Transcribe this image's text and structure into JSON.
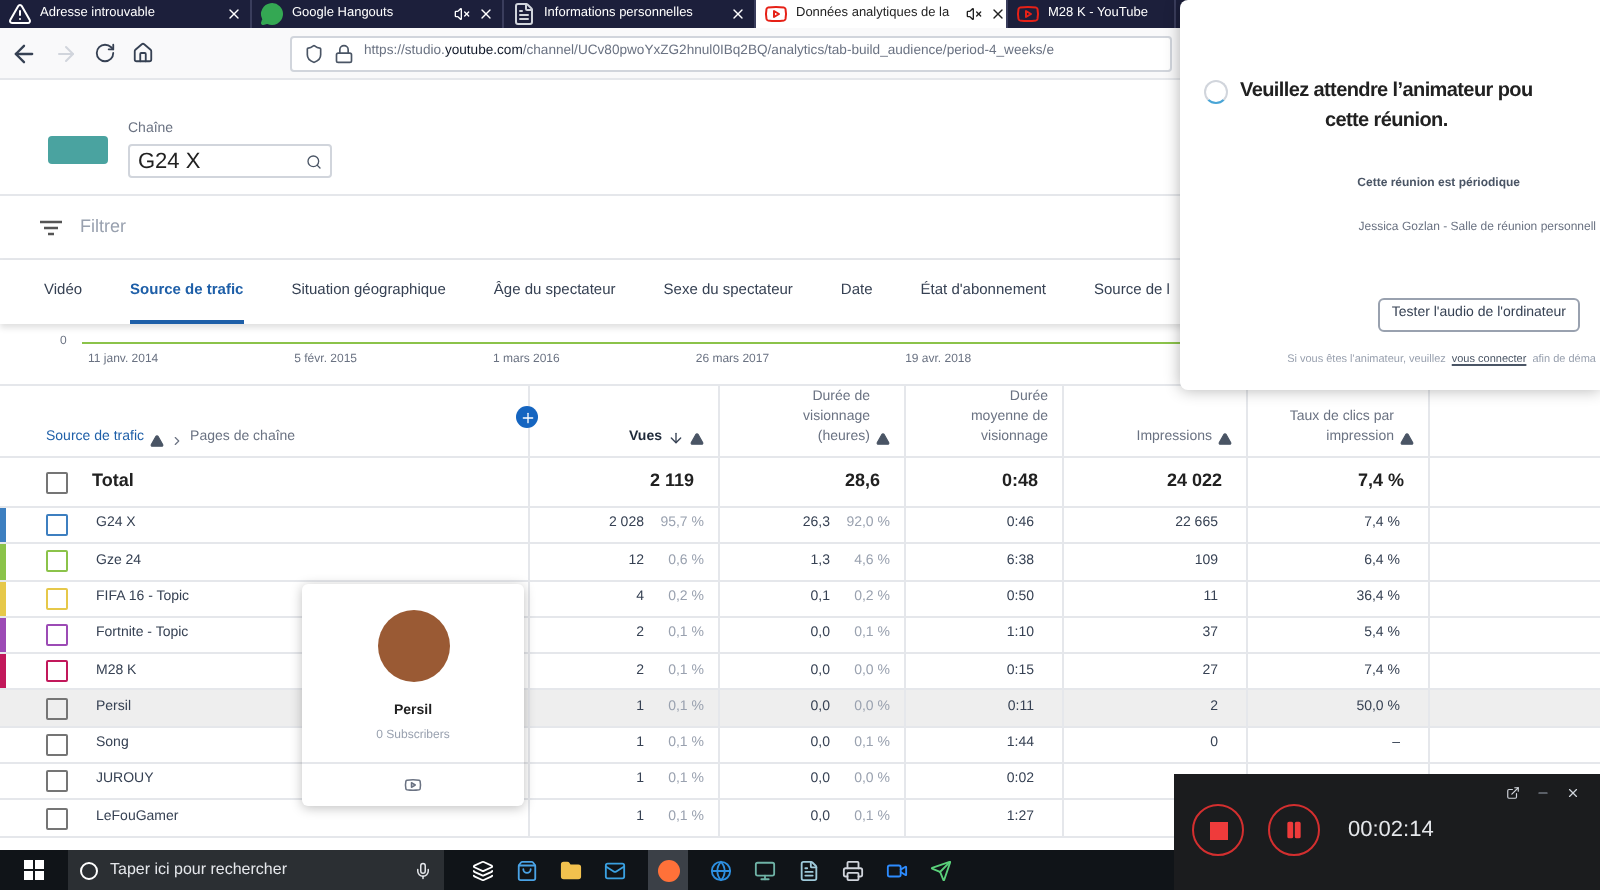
{
  "browser_tabs": [
    {
      "title": "Adresse introuvable",
      "kind": "warning",
      "muted": false,
      "selected": false
    },
    {
      "title": "Google Hangouts",
      "kind": "chat",
      "muted": true,
      "selected": false
    },
    {
      "title": "Informations personnelles",
      "kind": "document",
      "muted": false,
      "selected": false
    },
    {
      "title": "Données analytiques de la",
      "kind": "play",
      "muted": true,
      "selected": true
    },
    {
      "title": "M28 K - YouTube",
      "kind": "play",
      "muted": false,
      "selected": false
    }
  ],
  "address_bar": {
    "url": "https://studio.**youtube.com**/channel/UCv80pwoYxZG2hnul0IBq2BQ/analytics/tab-build_audience/period-4_weeks/e"
  },
  "channel": {
    "label": "Chaîne",
    "value": "G24 X"
  },
  "filter": {
    "placeholder": "Filtrer"
  },
  "report_tabs": [
    {
      "label": "Vidéo",
      "selected": false
    },
    {
      "label": "Source de trafic",
      "selected": true
    },
    {
      "label": "Situation géographique",
      "selected": false
    },
    {
      "label": "Âge du spectateur",
      "selected": false
    },
    {
      "label": "Sexe du spectateur",
      "selected": false
    },
    {
      "label": "Date",
      "selected": false
    },
    {
      "label": "État d'abonnement",
      "selected": false
    },
    {
      "label": "Source de l",
      "selected": false
    }
  ],
  "chart_axis": {
    "y_label": "0",
    "dates": [
      "11 janv. 2014",
      "5 févr. 2015",
      "1 mars 2016",
      "26 mars 2017",
      "19 avr. 2018"
    ]
  },
  "table": {
    "breadcrumb": {
      "link": "Source de trafic",
      "current": "Pages de chaîne"
    },
    "columns": [
      {
        "label": "Vues",
        "sorted": true,
        "warning": true
      },
      {
        "label": "Durée de visionnage (heures)",
        "sorted": false,
        "warning": true
      },
      {
        "label": "Durée moyenne de visionnage",
        "sorted": false,
        "warning": false
      },
      {
        "label": "Impressions",
        "sorted": false,
        "warning": true
      },
      {
        "label": "Taux de clics par impression",
        "sorted": false,
        "warning": true
      }
    ],
    "total": {
      "label": "Total",
      "checked": false,
      "views": "2 119",
      "hours": "28,6",
      "avg": "0:48",
      "impressions": "24 022",
      "ctr": "7,4 %"
    },
    "rows": [
      {
        "name": "G24 X",
        "color": "#3d7fc0",
        "checked": false,
        "highlighted": false,
        "views": "2 028",
        "views_pct": "95,7 %",
        "hours": "26,3",
        "hours_pct": "92,0 %",
        "avg": "0:46",
        "impressions": "22 665",
        "ctr": "7,4 %"
      },
      {
        "name": "Gze 24",
        "color": "#8bc34a",
        "checked": false,
        "highlighted": false,
        "views": "12",
        "views_pct": "0,6 %",
        "hours": "1,3",
        "hours_pct": "4,6 %",
        "avg": "6:38",
        "impressions": "109",
        "ctr": "6,4 %"
      },
      {
        "name": "FIFA 16 - Topic",
        "color": "#e6c84a",
        "checked": false,
        "highlighted": false,
        "views": "4",
        "views_pct": "0,2 %",
        "hours": "0,1",
        "hours_pct": "0,2 %",
        "avg": "0:50",
        "impressions": "11",
        "ctr": "36,4 %"
      },
      {
        "name": "Fortnite - Topic",
        "color": "#9c4bb5",
        "checked": false,
        "highlighted": false,
        "views": "2",
        "views_pct": "0,1 %",
        "hours": "0,0",
        "hours_pct": "0,1 %",
        "avg": "1:10",
        "impressions": "37",
        "ctr": "5,4 %"
      },
      {
        "name": "M28 K",
        "color": "#c2185b",
        "checked": false,
        "highlighted": false,
        "views": "2",
        "views_pct": "0,1 %",
        "hours": "0,0",
        "hours_pct": "0,0 %",
        "avg": "0:15",
        "impressions": "27",
        "ctr": "7,4 %"
      },
      {
        "name": "Persil",
        "checked": false,
        "highlighted": true,
        "views": "1",
        "views_pct": "0,1 %",
        "hours": "0,0",
        "hours_pct": "0,0 %",
        "avg": "0:11",
        "impressions": "2",
        "ctr": "50,0 %"
      },
      {
        "name": "Song",
        "checked": false,
        "highlighted": false,
        "views": "1",
        "views_pct": "0,1 %",
        "hours": "0,0",
        "hours_pct": "0,1 %",
        "avg": "1:44",
        "impressions": "0",
        "ctr": "–"
      },
      {
        "name": "JUROUY",
        "checked": false,
        "highlighted": false,
        "views": "1",
        "views_pct": "0,1 %",
        "hours": "0,0",
        "hours_pct": "0,0 %",
        "avg": "0:02"
      },
      {
        "name": "LeFouGamer",
        "checked": false,
        "highlighted": false,
        "views": "1",
        "views_pct": "0,1 %",
        "hours": "0,0",
        "hours_pct": "0,1 %",
        "avg": "1:27"
      }
    ]
  },
  "hover_card": {
    "name": "Persil",
    "subscribers": "0 Subscribers"
  },
  "meeting_panel": {
    "title_lines": [
      "Veuillez attendre l’animateur pou",
      "cette réunion."
    ],
    "recurring": "Cette réunion est périodique",
    "host": "Jessica Gozlan - Salle de réunion personnell",
    "test_button": "Tester l'audio de l'ordinateur",
    "footer": {
      "before": "Si vous êtes l'animateur, veuillez",
      "link": "vous connecter",
      "after": "afin de déma"
    }
  },
  "recorder": {
    "time": "00:02:14"
  },
  "taskbar": {
    "search_placeholder": "Taper ici pour rechercher"
  }
}
